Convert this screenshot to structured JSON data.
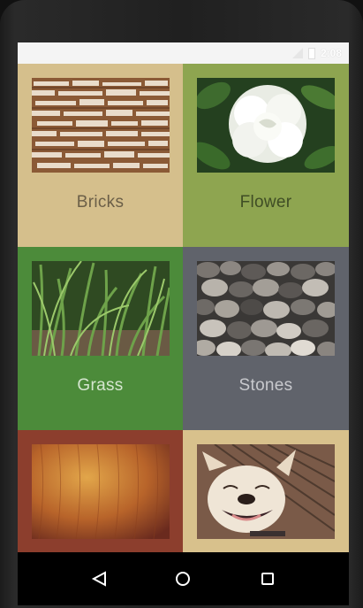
{
  "status": {
    "time": "2:08"
  },
  "tiles": [
    {
      "label": "Bricks",
      "bg": "#d5bf8c",
      "text_color": "#6b5f48"
    },
    {
      "label": "Flower",
      "bg": "#8ea550",
      "text_color": "#3f4d25"
    },
    {
      "label": "Grass",
      "bg": "#4c8b3a",
      "text_color": "#d5e6cf"
    },
    {
      "label": "Stones",
      "bg": "#60636b",
      "text_color": "#c8c9cd"
    },
    {
      "label": "",
      "bg": "#8c3e2d",
      "text_color": "#e0c9b0"
    },
    {
      "label": "",
      "bg": "#d8c18c",
      "text_color": "#6b5f48"
    }
  ],
  "navbar": {
    "back": "back-icon",
    "home": "home-icon",
    "recents": "recents-icon"
  }
}
